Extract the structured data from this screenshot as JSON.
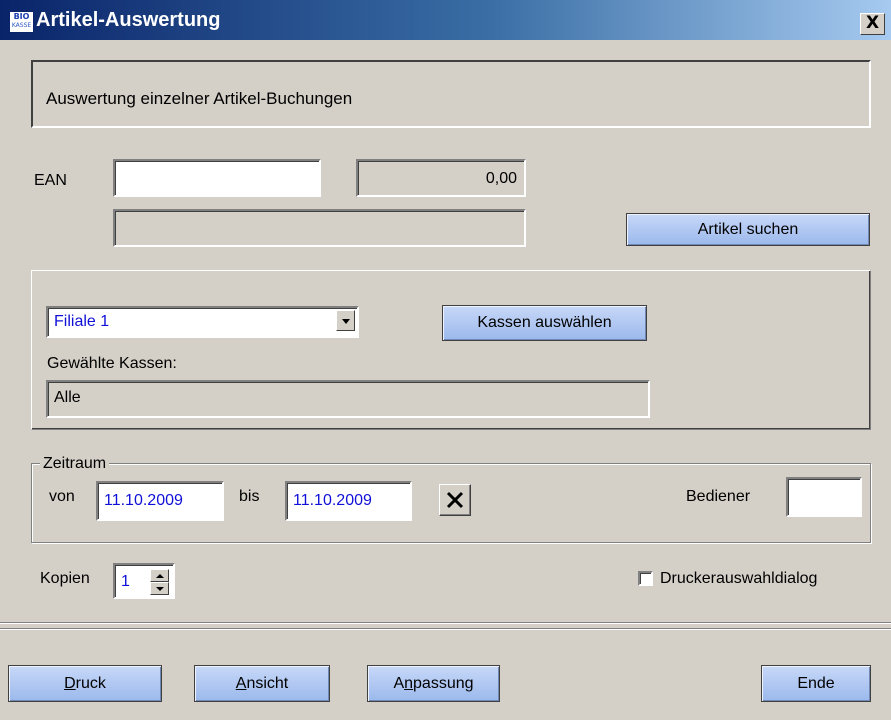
{
  "window": {
    "title": "Artikel-Auswertung",
    "icon_text_top": "BIO",
    "icon_text_bottom": "KASSE",
    "close_symbol": "X"
  },
  "header": {
    "text": "Auswertung einzelner Artikel-Buchungen"
  },
  "article": {
    "ean_label": "EAN",
    "ean_value": "",
    "price_value": "0,00",
    "description_value": "",
    "search_button": "Artikel suchen"
  },
  "register": {
    "branch_selected": "Filiale 1",
    "select_registers_button": "Kassen auswählen",
    "selected_registers_label": "Gewählte Kassen:",
    "selected_registers_value": "Alle"
  },
  "period": {
    "legend": "Zeitraum",
    "from_label": "von",
    "from_value": "11.10.2009",
    "to_label": "bis",
    "to_value": "11.10.2009",
    "operator_label": "Bediener",
    "operator_value": ""
  },
  "copies": {
    "label": "Kopien",
    "value": "1"
  },
  "printer_dialog": {
    "label": "Druckerauswahldialog",
    "checked": false
  },
  "buttons": {
    "print_pre": "",
    "print_key": "D",
    "print_post": "ruck",
    "view_pre": "",
    "view_key": "A",
    "view_post": "nsicht",
    "customize_pre": "A",
    "customize_key": "n",
    "customize_post": "passung",
    "end": "Ende"
  },
  "colors": {
    "window_bg": "#d4d0c8",
    "title_gradient_start": "#0a246a",
    "title_gradient_end": "#a6caf0",
    "button_blue": "#9bb9ec",
    "value_text_blue": "#1010d8"
  },
  "icons": {
    "app": "app-icon",
    "close": "close-icon",
    "dropdown": "chevron-down-icon",
    "clear": "x-icon",
    "spin_up": "arrow-up-icon",
    "spin_down": "arrow-down-icon"
  }
}
